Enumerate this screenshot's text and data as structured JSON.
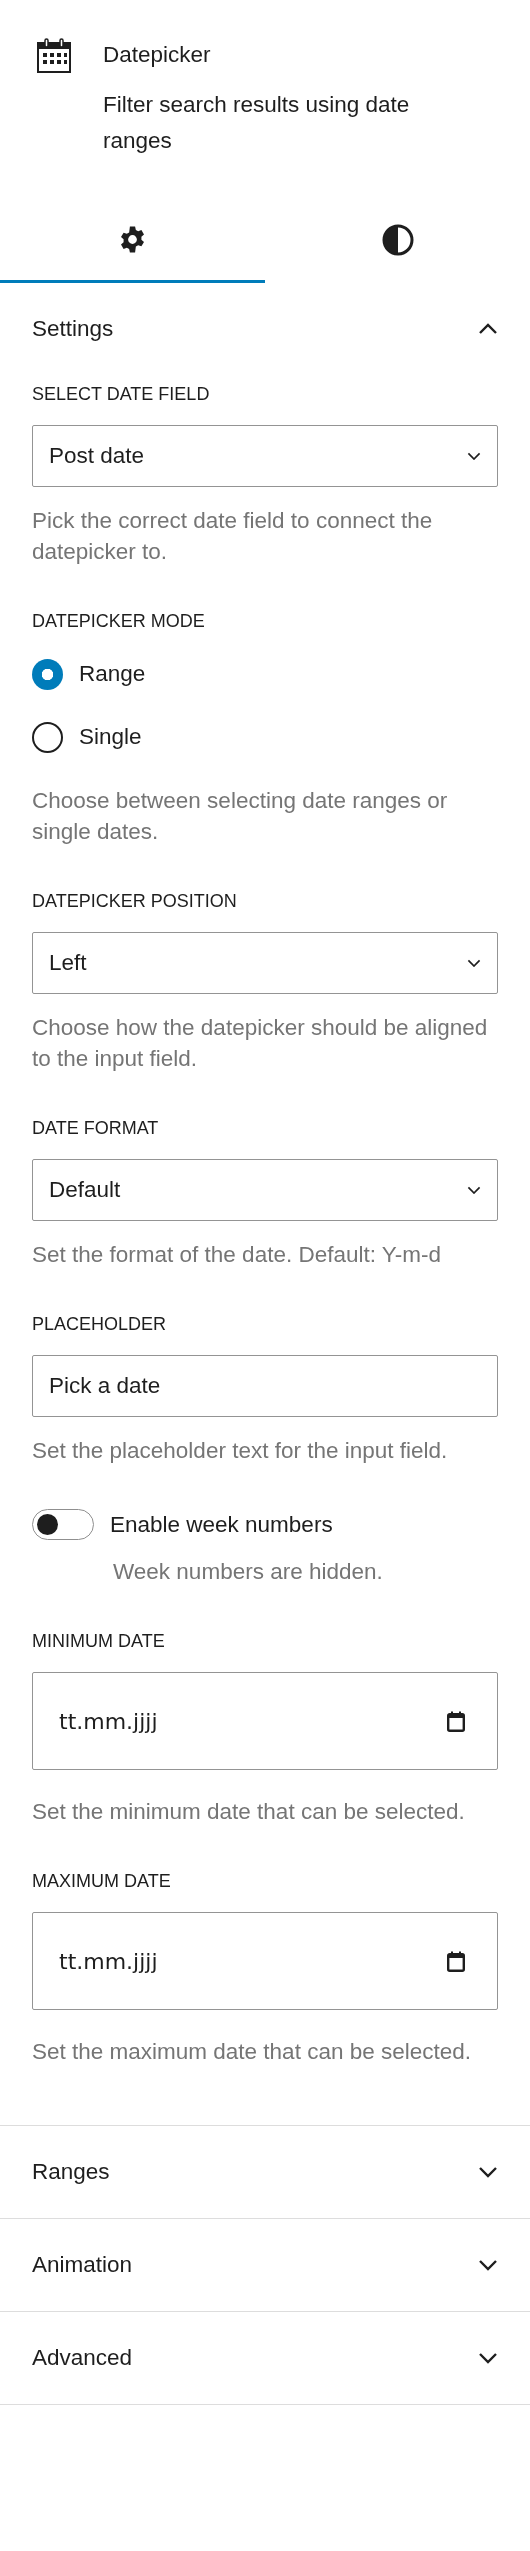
{
  "block": {
    "title": "Datepicker",
    "description": "Filter search results using date ranges"
  },
  "tabs": [
    {
      "kind": "settings",
      "selected": true
    },
    {
      "kind": "styles",
      "selected": false
    }
  ],
  "panels": [
    {
      "title": "Settings",
      "expanded": true,
      "fields": [
        {
          "kind": "select",
          "label": "SELECT DATE FIELD",
          "value": "Post date",
          "help": "Pick the correct date field to connect the datepicker to."
        },
        {
          "kind": "radio",
          "label": "DATEPICKER MODE",
          "options": [
            {
              "label": "Range",
              "selected": true
            },
            {
              "label": "Single",
              "selected": false
            }
          ],
          "help": "Choose between selecting date ranges or single dates."
        },
        {
          "kind": "select",
          "label": "DATEPICKER POSITION",
          "value": "Left",
          "help": "Choose how the datepicker should be aligned to the input field."
        },
        {
          "kind": "select",
          "label": "DATE FORMAT",
          "value": "Default",
          "help": "Set the format of the date. Default: Y-m-d"
        },
        {
          "kind": "text",
          "label": "PLACEHOLDER",
          "value": "Pick a date",
          "help": "Set the placeholder text for the input field."
        },
        {
          "kind": "toggle",
          "label": "Enable week numbers",
          "on": false,
          "help": "Week numbers are hidden."
        },
        {
          "kind": "date",
          "label": "MINIMUM DATE",
          "placeholder": "tt.mm.jjjj",
          "help": "Set the minimum date that can be selected."
        },
        {
          "kind": "date",
          "label": "MAXIMUM DATE",
          "placeholder": "tt.mm.jjjj",
          "help": "Set the maximum date that can be selected."
        }
      ]
    },
    {
      "title": "Ranges",
      "expanded": false
    },
    {
      "title": "Animation",
      "expanded": false
    },
    {
      "title": "Advanced",
      "expanded": false
    }
  ]
}
